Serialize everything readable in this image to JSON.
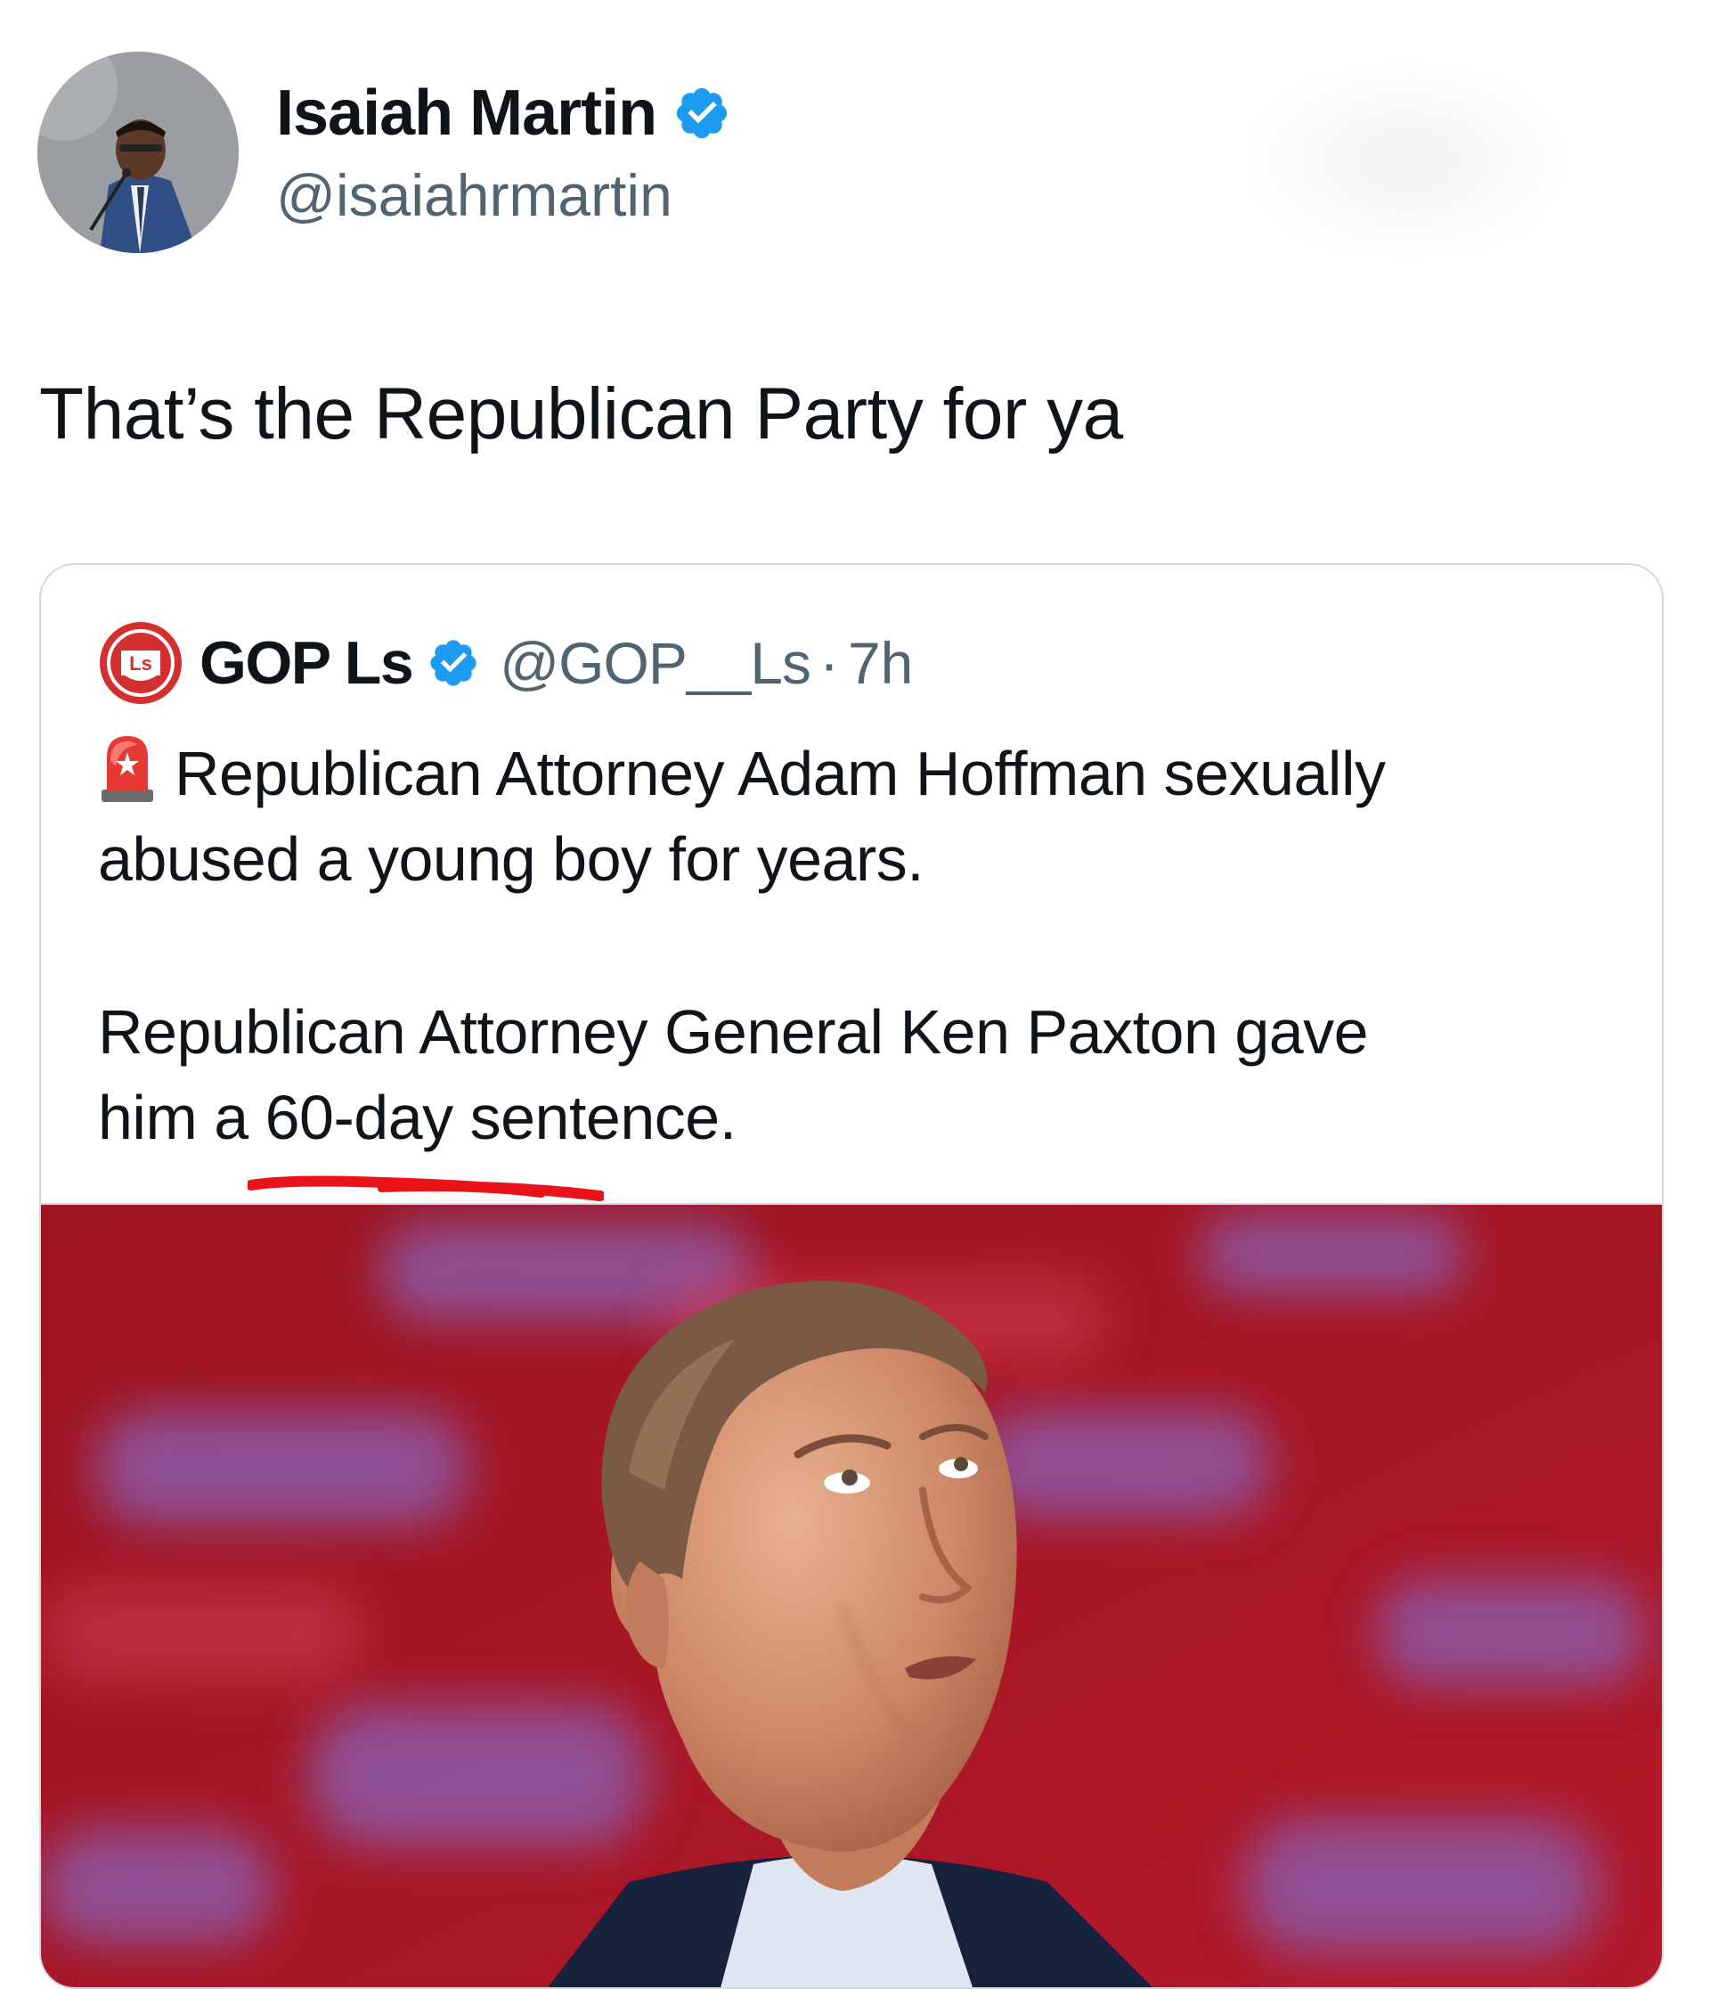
{
  "post": {
    "author": {
      "display_name": "Isaiah Martin",
      "handle": "@isaiahrmartin",
      "verified_icon": "verified-badge-icon",
      "avatar": "profile-photo"
    },
    "text": "That’s the Republican Party for ya"
  },
  "quote": {
    "author": {
      "display_name": "GOP Ls",
      "handle": "@GOP__Ls",
      "separator": "·",
      "time": "7h",
      "logo_text": "Ls",
      "verified_icon": "verified-badge-icon"
    },
    "emoji": "rotating-light-icon",
    "paragraph1": "Republican Attorney Adam Hoffman sexually abused a young boy for years.",
    "paragraph2_line1": "Republican Attorney General Ken Paxton gave",
    "paragraph2_line2": "him a 60-day sentence.",
    "image": "photo of man looking upward against red background"
  },
  "colors": {
    "verified_blue": "#1d9bf0",
    "handle_gray": "#536471",
    "text": "#0f1419",
    "border": "#cfd9de",
    "logo_red": "#d32f2f",
    "underline_red": "#e8141a"
  }
}
